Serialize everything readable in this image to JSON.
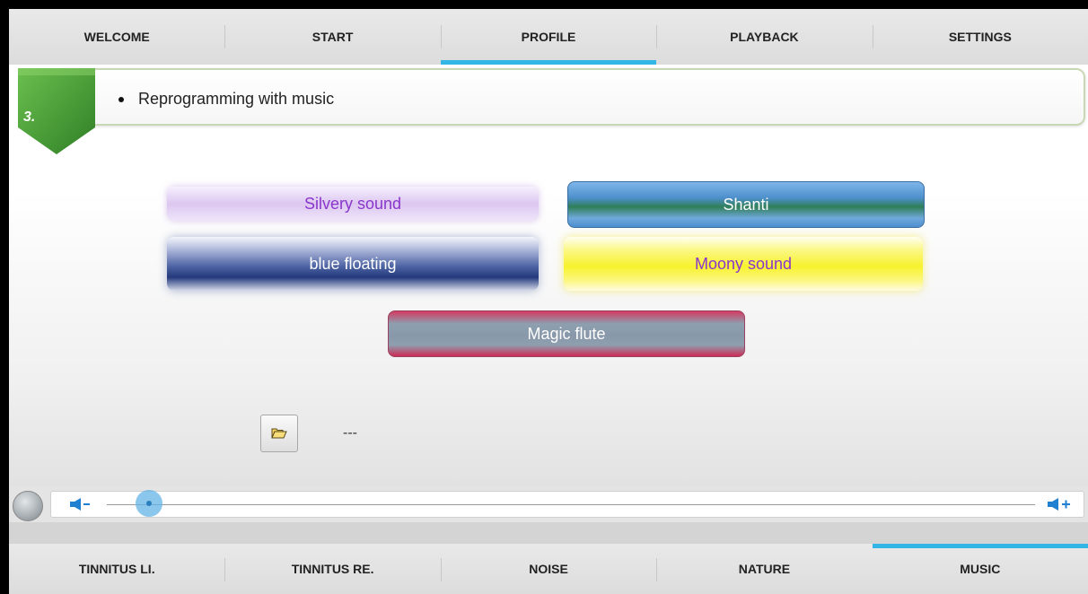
{
  "top_tabs": [
    "WELCOME",
    "START",
    "PROFILE",
    "PLAYBACK",
    "SETTINGS"
  ],
  "active_top_tab": "PROFILE",
  "step": {
    "number": "3.",
    "text": "Reprogramming with music"
  },
  "music_buttons": {
    "silvery": "Silvery sound",
    "shanti": "Shanti",
    "blue": "blue floating",
    "moony": "Moony sound",
    "magic": "Magic flute"
  },
  "file": {
    "name": "---",
    "icon": "folder-open-icon"
  },
  "volume": {
    "level": 0.04
  },
  "bottom_tabs": [
    "TINNITUS LI.",
    "TINNITUS RE.",
    "NOISE",
    "NATURE",
    "MUSIC"
  ],
  "active_bottom_tab": "MUSIC",
  "colors": {
    "accent": "#33b5e5",
    "step_green": "#3f9b3a"
  }
}
